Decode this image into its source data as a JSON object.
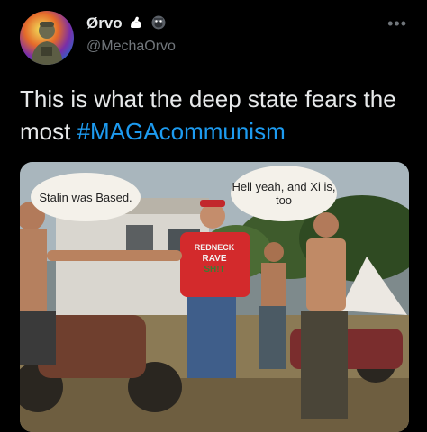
{
  "tweet": {
    "author": {
      "display_name": "Ørvo",
      "handle": "@MechaOrvo",
      "badges": [
        "flexed-biceps-icon",
        "gorilla-icon"
      ]
    },
    "text_main": "This is what the deep state fears the most ",
    "hashtag": "#MAGAcommunism",
    "media": {
      "speech_bubbles": [
        "Stalin was Based.",
        "Hell yeah, and Xi is, too"
      ],
      "shirt_text": [
        "REDNECK",
        "RAVE",
        "SH!T"
      ]
    }
  },
  "colors": {
    "background": "#000000",
    "text": "#e7e9ea",
    "secondary_text": "#71767b",
    "link": "#1d9bf0"
  }
}
